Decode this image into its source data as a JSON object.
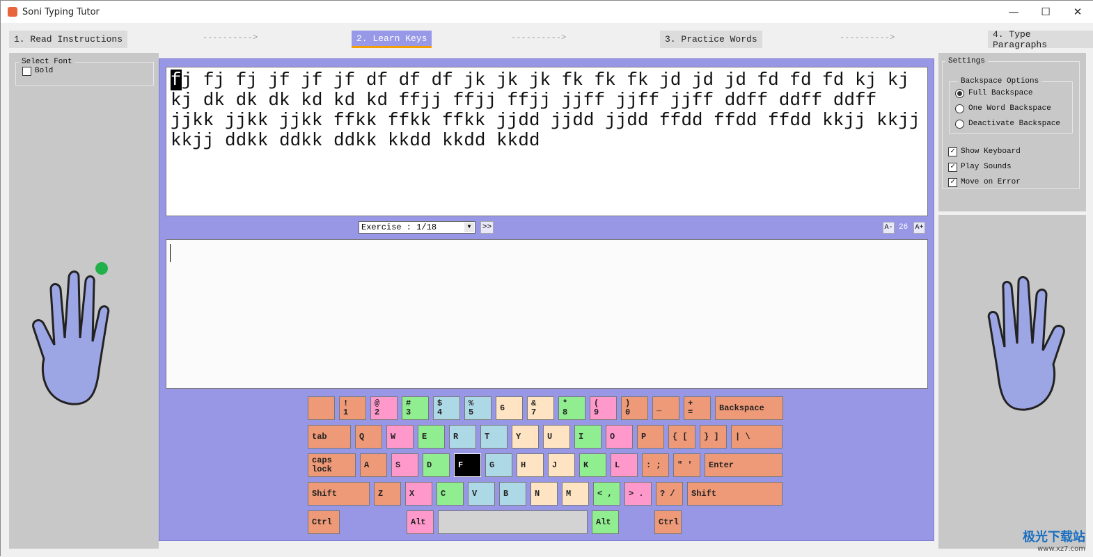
{
  "window": {
    "title": "Soni Typing Tutor",
    "minimize": "—",
    "maximize": "☐",
    "close": "✕"
  },
  "steps": [
    {
      "label": "1. Read Instructions"
    },
    {
      "label": "2. Learn Keys"
    },
    {
      "label": "3. Practice Words"
    },
    {
      "label": "4. Type Paragraphs"
    }
  ],
  "arrow": "---------->",
  "left_panel": {
    "group": "Select Font",
    "bold_label": "Bold",
    "bold_checked": false
  },
  "settings": {
    "title": "Settings",
    "backspace_group": "Backspace Options",
    "radios": [
      {
        "label": "Full Backspace",
        "selected": true
      },
      {
        "label": "One Word Backspace",
        "selected": false
      },
      {
        "label": "Deactivate Backspace",
        "selected": false
      }
    ],
    "checks": [
      {
        "label": "Show Keyboard",
        "checked": true
      },
      {
        "label": "Play Sounds",
        "checked": true
      },
      {
        "label": "Move on Error",
        "checked": true
      }
    ]
  },
  "lesson": {
    "current_char": "f",
    "rest": "j fj fj jf jf jf df df df jk jk jk fk fk fk jd jd jd fd fd fd kj kj kj dk dk dk kd kd kd ffjj ffjj ffjj jjff jjff jjff ddff ddff ddff jjkk jjkk jjkk ffkk ffkk ffkk jjdd jjdd jjdd ffdd ffdd ffdd kkjj kkjj kkjj ddkk ddkk ddkk kkdd kkdd kkdd"
  },
  "exercise": {
    "value": "Exercise : 1/18",
    "next": ">>"
  },
  "font_size": {
    "decrease": "A-",
    "value": "26",
    "increase": "A+"
  },
  "input_value": "",
  "keyboard": [
    [
      {
        "top": "",
        "bot": "",
        "color": "orange"
      },
      {
        "top": "!",
        "bot": "1",
        "color": "orange"
      },
      {
        "top": "@",
        "bot": "2",
        "color": "pink"
      },
      {
        "top": "#",
        "bot": "3",
        "color": "green"
      },
      {
        "top": "$",
        "bot": "4",
        "color": "blue"
      },
      {
        "top": "%",
        "bot": "5",
        "color": "blue"
      },
      {
        "top": "",
        "bot": "6",
        "color": "beige"
      },
      {
        "top": "&",
        "bot": "7",
        "color": "beige"
      },
      {
        "top": "*",
        "bot": "8",
        "color": "green"
      },
      {
        "top": "(",
        "bot": "9",
        "color": "pink"
      },
      {
        "top": ")",
        "bot": "0",
        "color": "orange"
      },
      {
        "top": "",
        "bot": "_",
        "color": "orange"
      },
      {
        "top": "+",
        "bot": "=",
        "color": "orange"
      },
      {
        "top": "Backspace",
        "bot": "",
        "color": "orange",
        "kind": "backspace"
      }
    ],
    [
      {
        "top": "tab",
        "bot": "",
        "color": "orange",
        "kind": "tab"
      },
      {
        "top": "Q",
        "color": "orange"
      },
      {
        "top": "W",
        "color": "pink"
      },
      {
        "top": "E",
        "color": "green"
      },
      {
        "top": "R",
        "color": "blue"
      },
      {
        "top": "T",
        "color": "blue"
      },
      {
        "top": "Y",
        "color": "beige"
      },
      {
        "top": "U",
        "color": "beige"
      },
      {
        "top": "I",
        "color": "green"
      },
      {
        "top": "O",
        "color": "pink"
      },
      {
        "top": "P",
        "color": "orange"
      },
      {
        "top": "{  [",
        "color": "orange"
      },
      {
        "top": "}  ]",
        "color": "orange"
      },
      {
        "top": "|     \\",
        "color": "orange",
        "kind": "backslash"
      }
    ],
    [
      {
        "top": "caps",
        "bot": "lock",
        "color": "orange",
        "kind": "caps"
      },
      {
        "top": "A",
        "color": "orange"
      },
      {
        "top": "S",
        "color": "pink"
      },
      {
        "top": "D",
        "color": "green"
      },
      {
        "top": "F",
        "color": "black"
      },
      {
        "top": "G",
        "color": "blue"
      },
      {
        "top": "H",
        "color": "beige"
      },
      {
        "top": "J",
        "color": "beige"
      },
      {
        "top": "K",
        "color": "green"
      },
      {
        "top": "L",
        "color": "pink"
      },
      {
        "top": ":  ;",
        "color": "orange"
      },
      {
        "top": "\"  '",
        "color": "orange"
      },
      {
        "top": "Enter",
        "color": "orange",
        "kind": "enter"
      }
    ],
    [
      {
        "top": "Shift",
        "color": "orange",
        "kind": "lshift"
      },
      {
        "top": "Z",
        "color": "orange"
      },
      {
        "top": "X",
        "color": "pink"
      },
      {
        "top": "C",
        "color": "green"
      },
      {
        "top": "V",
        "color": "blue"
      },
      {
        "top": "B",
        "color": "blue"
      },
      {
        "top": "N",
        "color": "beige"
      },
      {
        "top": "M",
        "color": "beige"
      },
      {
        "top": "<  ,",
        "color": "green"
      },
      {
        "top": ">  .",
        "color": "pink"
      },
      {
        "top": "?  /",
        "color": "orange"
      },
      {
        "top": "Shift",
        "color": "orange",
        "kind": "rshift"
      }
    ],
    [
      {
        "top": "Ctrl",
        "color": "orange",
        "kind": "ctrl"
      },
      {
        "top": "Alt",
        "color": "pink",
        "kind": "lalt"
      },
      {
        "top": "",
        "color": "gray",
        "kind": "space"
      },
      {
        "top": "Alt",
        "color": "green"
      },
      {
        "top": "Ctrl",
        "color": "orange",
        "kind": "rctrl"
      }
    ]
  ],
  "colors": {
    "accent": "#9797e6",
    "active_underline": "#f5a000",
    "finger_dot": "#22b04a",
    "hand": "#9da6e4"
  },
  "watermark": {
    "text": "极光下载站",
    "url": "www.xz7.com"
  }
}
